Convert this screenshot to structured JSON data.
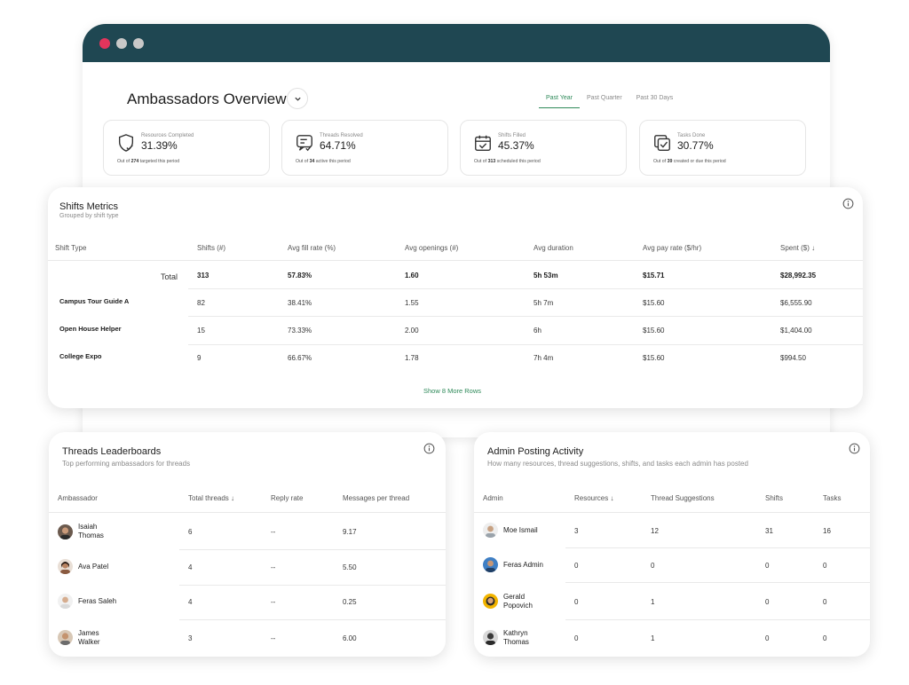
{
  "window": {
    "title": "Ambassadors Overview",
    "tabs": [
      "Past Year",
      "Past Quarter",
      "Past 30 Days"
    ],
    "active_tab": 0,
    "kpis": [
      {
        "icon": "shield-check-icon",
        "label": "Resources Completed",
        "value": "31.39%",
        "foot_pre": "Out of ",
        "foot_num": "274",
        "foot_post": " targeted this period"
      },
      {
        "icon": "message-check-icon",
        "label": "Threads Resolved",
        "value": "64.71%",
        "foot_pre": "Out of ",
        "foot_num": "34",
        "foot_post": " active this period"
      },
      {
        "icon": "calendar-check-icon",
        "label": "Shifts Filled",
        "value": "45.37%",
        "foot_pre": "Out of ",
        "foot_num": "313",
        "foot_post": " scheduled this period"
      },
      {
        "icon": "tasks-check-icon",
        "label": "Tasks Done",
        "value": "30.77%",
        "foot_pre": "Out of ",
        "foot_num": "39",
        "foot_post": " created or due this period"
      }
    ]
  },
  "shifts": {
    "title": "Shifts Metrics",
    "subtitle": "Grouped by shift type",
    "columns": [
      "Shift Type",
      "Shifts (#)",
      "Avg fill rate (%)",
      "Avg openings (#)",
      "Avg duration",
      "Avg pay rate ($/hr)",
      "Spent ($)"
    ],
    "total": {
      "label": "Total",
      "values": [
        "313",
        "57.83%",
        "1.60",
        "5h 53m",
        "$15.71",
        "$28,992.35"
      ]
    },
    "rows": [
      {
        "name": "Campus Tour Guide A",
        "values": [
          "82",
          "38.41%",
          "1.55",
          "5h 7m",
          "$15.60",
          "$6,555.90"
        ]
      },
      {
        "name": "Open House Helper",
        "values": [
          "15",
          "73.33%",
          "2.00",
          "6h",
          "$15.60",
          "$1,404.00"
        ]
      },
      {
        "name": "College Expo",
        "values": [
          "9",
          "66.67%",
          "1.78",
          "7h 4m",
          "$15.60",
          "$994.50"
        ]
      }
    ],
    "show_more": "Show 8 More Rows"
  },
  "threads": {
    "title": "Threads Leaderboards",
    "subtitle": "Top performing ambassadors for threads",
    "columns": [
      "Ambassador",
      "Total threads",
      "Reply rate",
      "Messages per thread"
    ],
    "rows": [
      {
        "name1": "Isaiah",
        "name2": "Thomas",
        "values": [
          "6",
          "--",
          "9.17"
        ]
      },
      {
        "name1": "Ava Patel",
        "name2": "",
        "values": [
          "4",
          "--",
          "5.50"
        ]
      },
      {
        "name1": "Feras Saleh",
        "name2": "",
        "values": [
          "4",
          "--",
          "0.25"
        ]
      },
      {
        "name1": "James",
        "name2": "Walker",
        "values": [
          "3",
          "--",
          "6.00"
        ]
      }
    ]
  },
  "admin": {
    "title": "Admin Posting Activity",
    "subtitle": "How many resources, thread suggestions, shifts, and tasks each admin has posted",
    "columns": [
      "Admin",
      "Resources",
      "Thread Suggestions",
      "Shifts",
      "Tasks"
    ],
    "rows": [
      {
        "name1": "Moe Ismail",
        "name2": "",
        "values": [
          "3",
          "12",
          "31",
          "16"
        ]
      },
      {
        "name1": "Feras Admin",
        "name2": "",
        "values": [
          "0",
          "0",
          "0",
          "0"
        ]
      },
      {
        "name1": "Gerald",
        "name2": "Popovich",
        "values": [
          "0",
          "1",
          "0",
          "0"
        ]
      },
      {
        "name1": "Kathryn",
        "name2": "Thomas",
        "values": [
          "0",
          "1",
          "0",
          "0"
        ]
      }
    ]
  },
  "colors": {
    "titlebar": "#1f4752",
    "accent": "#2f8a5a",
    "close_dot": "#e2355c"
  }
}
